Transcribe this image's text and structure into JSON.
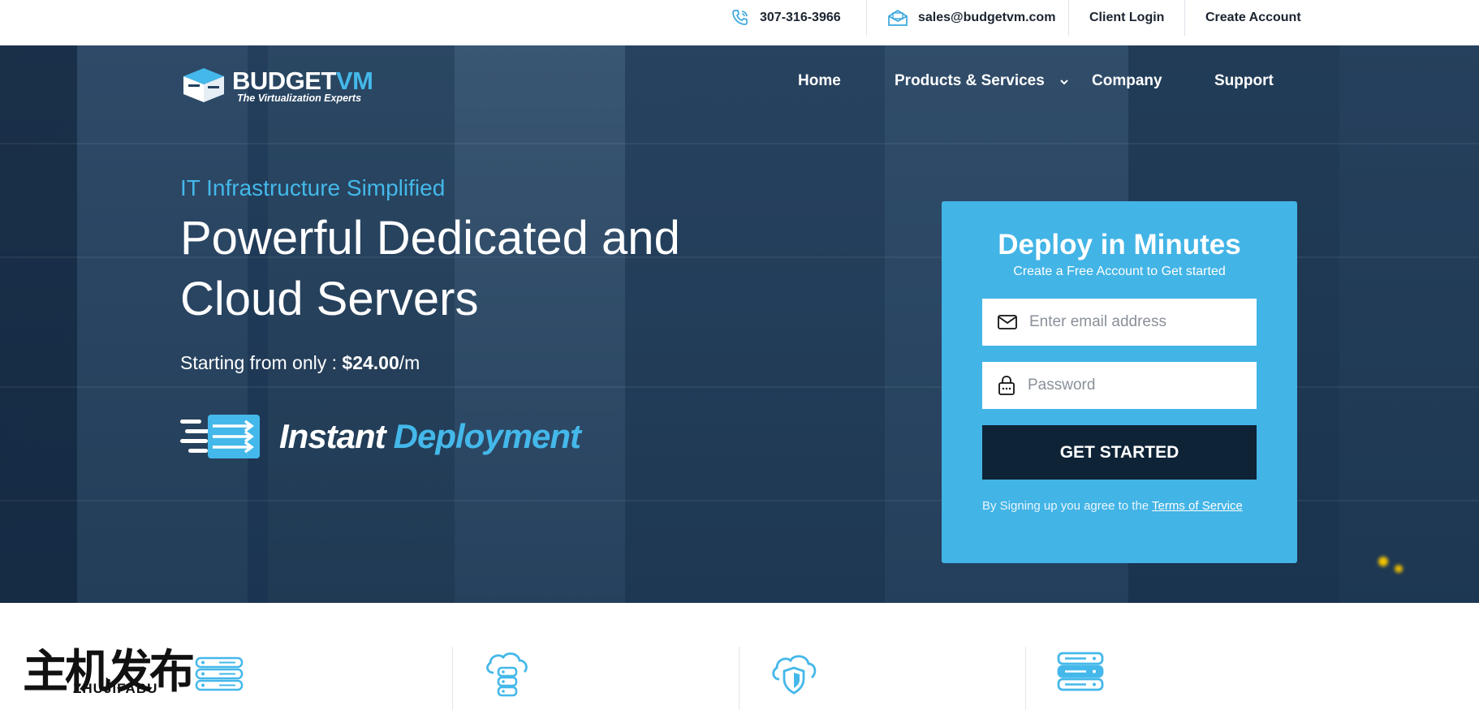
{
  "topbar": {
    "phone": "307-316-3966",
    "email": "sales@budgetvm.com",
    "client_login": "Client Login",
    "create_account": "Create Account"
  },
  "logo": {
    "brand_main": "BUDGET",
    "brand_accent": "VM",
    "tagline": "The Virtualization Experts"
  },
  "nav": {
    "items": [
      {
        "label": "Home"
      },
      {
        "label": "Products & Services",
        "has_dropdown": true
      },
      {
        "label": "Company"
      },
      {
        "label": "Support"
      }
    ]
  },
  "hero": {
    "eyebrow": "IT Infrastructure Simplified",
    "headline_line1": "Powerful Dedicated and",
    "headline_line2": "Cloud Servers",
    "price_prefix": "Starting from only : ",
    "price_value": "$24.00",
    "price_suffix": "/m",
    "badge_word1": "Instant",
    "badge_word2": "Deployment"
  },
  "signup": {
    "title": "Deploy in Minutes",
    "subtitle": "Create a Free Account to Get started",
    "email_placeholder": "Enter email address",
    "password_placeholder": "Password",
    "button_label": "GET STARTED",
    "terms_prefix": "By Signing up you agree to the ",
    "terms_link": "Terms of Service"
  },
  "watermark": {
    "cn": "主机发布",
    "en": "ZHUJIFABU"
  },
  "features": {
    "icons": [
      "cloud-server-icon",
      "cloud-shield-icon",
      "server-stack-icon"
    ]
  },
  "colors": {
    "accent": "#44b8ea",
    "card": "#42b4e6",
    "cta": "#0f2337",
    "hero_bg": "#23415f"
  }
}
